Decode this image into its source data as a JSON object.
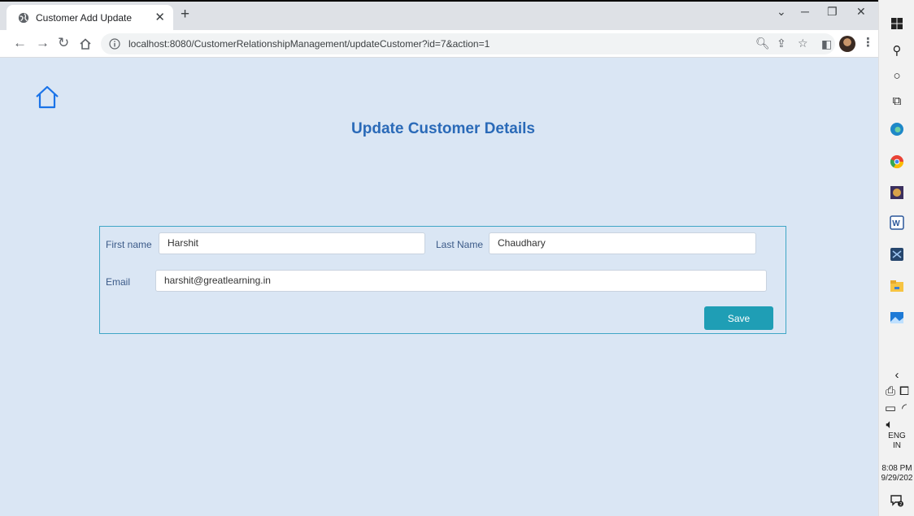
{
  "browser": {
    "tab_title": "Customer Add Update",
    "url": "localhost:8080/CustomerRelationshipManagement/updateCustomer?id=7&action=1"
  },
  "page": {
    "heading": "Update Customer Details",
    "form": {
      "first_name_label": "First name",
      "first_name_value": "Harshit",
      "last_name_label": "Last Name",
      "last_name_value": "Chaudhary",
      "email_label": "Email",
      "email_value": "harshit@greatlearning.in",
      "save_label": "Save"
    }
  },
  "taskbar": {
    "language": "ENG",
    "region": "IN",
    "time": "8:08 PM",
    "date": "9/29/202"
  },
  "colors": {
    "page_background": "#dae6f4",
    "heading": "#2a6ab8",
    "save_button": "#1f9eb5",
    "form_border": "#3fa6c6"
  }
}
